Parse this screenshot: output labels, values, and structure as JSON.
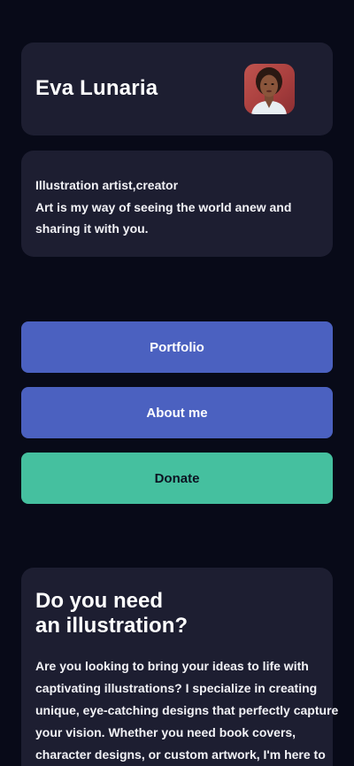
{
  "profile": {
    "name": "Eva Lunaria"
  },
  "bio": {
    "lines": [
      "Illustration artist,creator",
      "Art is my way of seeing the world anew and",
      "sharing it with you."
    ]
  },
  "buttons": {
    "portfolio": "Portfolio",
    "about": "About me",
    "donate": "Donate"
  },
  "promo": {
    "heading_lines": [
      "Do you need",
      "an illustration?"
    ],
    "text_lines": [
      "Are you looking to bring your ideas to life with",
      "captivating illustrations? I specialize in creating",
      "unique, eye-catching designs that perfectly capture",
      "your vision. Whether you need book covers,",
      "character designs, or custom artwork, I'm here to"
    ]
  },
  "colors": {
    "page_background": "#080a18",
    "card_background": "#1d1e31",
    "primary_button": "#4b61c0",
    "donate_button": "#45c09f"
  }
}
